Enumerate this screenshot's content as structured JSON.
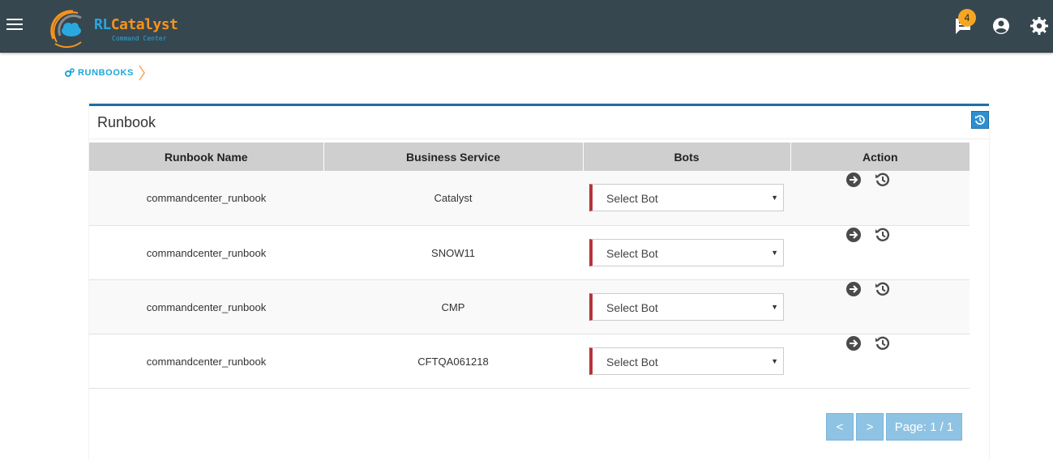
{
  "header": {
    "logo_primary": "RL",
    "logo_secondary": "Catalyst",
    "logo_subtitle": "Command Center",
    "notification_count": "4",
    "accent_color": "#37474f"
  },
  "breadcrumb": {
    "icon": "cogs-icon",
    "label": "RUNBOOKS"
  },
  "panel": {
    "title": "Runbook"
  },
  "table": {
    "columns": [
      "Runbook Name",
      "Business Service",
      "Bots",
      "Action"
    ],
    "rows": [
      {
        "runbook_name": "commandcenter_runbook",
        "business_service": "Catalyst",
        "bot": "Select Bot"
      },
      {
        "runbook_name": "commandcenter_runbook",
        "business_service": "SNOW11",
        "bot": "Select Bot"
      },
      {
        "runbook_name": "commandcenter_runbook",
        "business_service": "CMP",
        "bot": "Select Bot"
      },
      {
        "runbook_name": "commandcenter_runbook",
        "business_service": "CFTQA061218",
        "bot": "Select Bot"
      }
    ]
  },
  "pager": {
    "prev_label": "<",
    "next_label": ">",
    "page_label": "Page: 1 / 1"
  }
}
